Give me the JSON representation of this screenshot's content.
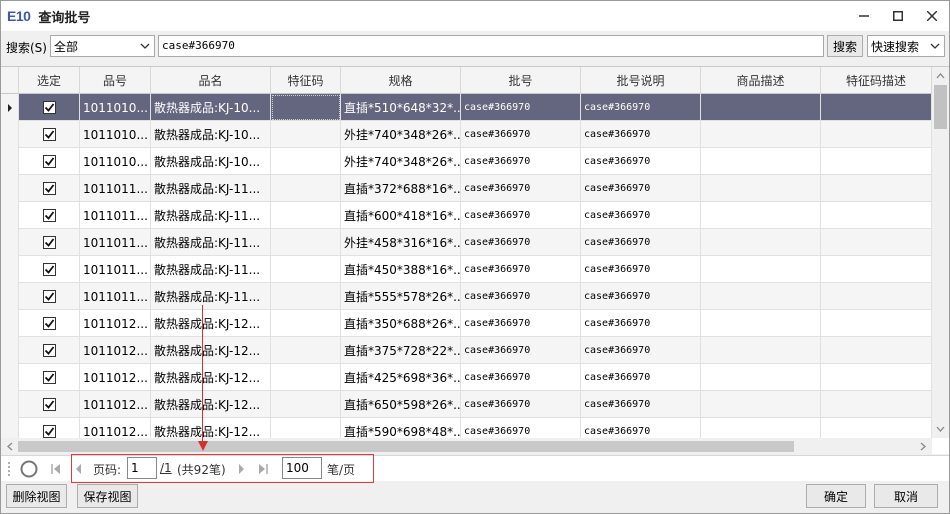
{
  "window": {
    "logo": "E10",
    "title": "查询批号"
  },
  "search": {
    "label": "搜索(S)",
    "scope_value": "全部",
    "query": "case#366970",
    "search_button": "搜索",
    "mode_value": "快速搜索"
  },
  "grid": {
    "columns": [
      "选定",
      "品号",
      "品名",
      "特征码",
      "规格",
      "批号",
      "批号说明",
      "商品描述",
      "特征码描述"
    ],
    "rows": [
      {
        "code": "1011010...",
        "name": "散热器成品:KJ-10...",
        "spec": "直插*510*648*32*...",
        "batch": "case#366970",
        "batch_desc": "case#366970"
      },
      {
        "code": "1011010...",
        "name": "散热器成品:KJ-10...",
        "spec": "外挂*740*348*26*...",
        "batch": "case#366970",
        "batch_desc": "case#366970"
      },
      {
        "code": "1011010...",
        "name": "散热器成品:KJ-10...",
        "spec": "外挂*740*348*26*...",
        "batch": "case#366970",
        "batch_desc": "case#366970"
      },
      {
        "code": "1011011...",
        "name": "散热器成品:KJ-11...",
        "spec": "直插*372*688*16*...",
        "batch": "case#366970",
        "batch_desc": "case#366970"
      },
      {
        "code": "1011011...",
        "name": "散热器成品:KJ-11...",
        "spec": "直插*600*418*16*...",
        "batch": "case#366970",
        "batch_desc": "case#366970"
      },
      {
        "code": "1011011...",
        "name": "散热器成品:KJ-11...",
        "spec": "外挂*458*316*16*...",
        "batch": "case#366970",
        "batch_desc": "case#366970"
      },
      {
        "code": "1011011...",
        "name": "散热器成品:KJ-11...",
        "spec": "直插*450*388*16*...",
        "batch": "case#366970",
        "batch_desc": "case#366970"
      },
      {
        "code": "1011011...",
        "name": "散热器成品:KJ-11...",
        "spec": "直插*555*578*26*...",
        "batch": "case#366970",
        "batch_desc": "case#366970"
      },
      {
        "code": "1011012...",
        "name": "散热器成品:KJ-12...",
        "spec": "直插*350*688*26*...",
        "batch": "case#366970",
        "batch_desc": "case#366970"
      },
      {
        "code": "1011012...",
        "name": "散热器成品:KJ-12...",
        "spec": "直插*375*728*22*...",
        "batch": "case#366970",
        "batch_desc": "case#366970"
      },
      {
        "code": "1011012...",
        "name": "散热器成品:KJ-12...",
        "spec": "直插*425*698*36*...",
        "batch": "case#366970",
        "batch_desc": "case#366970"
      },
      {
        "code": "1011012...",
        "name": "散热器成品:KJ-12...",
        "spec": "直插*650*598*26*...",
        "batch": "case#366970",
        "batch_desc": "case#366970"
      },
      {
        "code": "1011012...",
        "name": "散热器成品:KJ-12...",
        "spec": "直插*590*698*48*...",
        "batch": "case#366970",
        "batch_desc": "case#366970"
      }
    ]
  },
  "pager": {
    "page_label": "页码:",
    "page_value": "1",
    "total_pages": "/1",
    "total_records": "(共92笔)",
    "page_size": "100",
    "page_size_unit": "笔/页"
  },
  "footer": {
    "delete_view": "删除视图",
    "save_view": "保存视图",
    "ok": "确定",
    "cancel": "取消"
  },
  "colors": {
    "selected_row": "#64657e",
    "annotation": "#d43030",
    "logo": "#3b58a8"
  }
}
